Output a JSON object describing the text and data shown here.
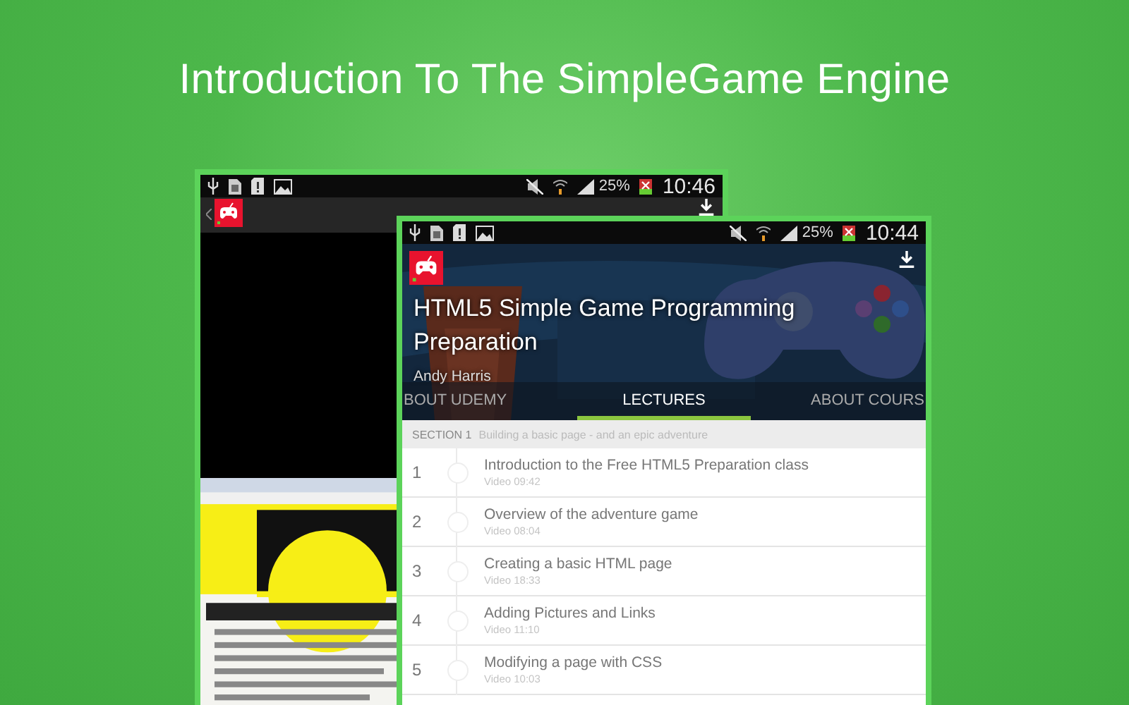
{
  "headline": "Introduction To The SimpleGame Engine",
  "back_screen": {
    "status_bar": {
      "battery": "25%",
      "time": "10:46"
    }
  },
  "front_screen": {
    "status_bar": {
      "battery": "25%",
      "time": "10:44"
    },
    "course": {
      "title": "HTML5 Simple Game Programming Preparation",
      "author": "Andy Harris"
    },
    "tabs": [
      {
        "label": "BOUT UDEMY",
        "selected": false
      },
      {
        "label": "LECTURES",
        "selected": true
      },
      {
        "label": "ABOUT COURS",
        "selected": false
      }
    ],
    "section": {
      "label": "SECTION 1",
      "title": "Building a basic page - and an epic adventure"
    },
    "lectures": [
      {
        "number": "1",
        "title": "Introduction to the Free HTML5 Preparation class",
        "meta": "Video 09:42"
      },
      {
        "number": "2",
        "title": "Overview of the adventure game",
        "meta": "Video 08:04"
      },
      {
        "number": "3",
        "title": "Creating a basic HTML page",
        "meta": "Video 18:33"
      },
      {
        "number": "4",
        "title": "Adding Pictures and Links",
        "meta": "Video 11:10"
      },
      {
        "number": "5",
        "title": "Modifying a page with CSS",
        "meta": "Video 10:03"
      }
    ]
  }
}
